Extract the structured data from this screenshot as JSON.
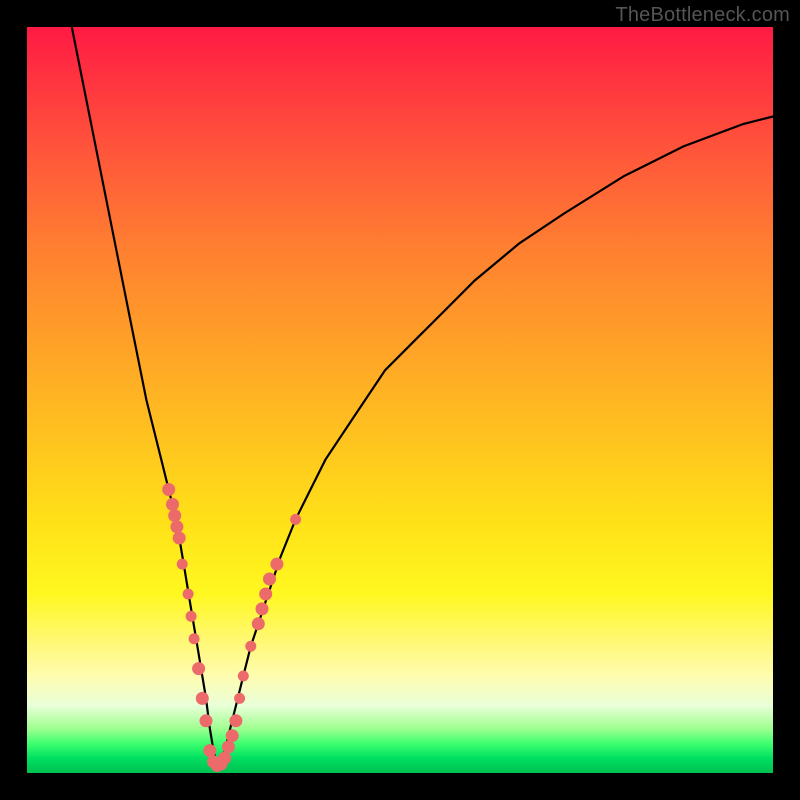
{
  "watermark": "TheBottleneck.com",
  "chart_data": {
    "type": "line",
    "title": "",
    "xlabel": "",
    "ylabel": "",
    "xlim": [
      0,
      100
    ],
    "ylim": [
      0,
      100
    ],
    "optimum_x": 25.5,
    "series": [
      {
        "name": "bottleneck-curve",
        "x": [
          6,
          8,
          10,
          12,
          14,
          16,
          18,
          19,
          20,
          21,
          22,
          23,
          24,
          24.5,
          25,
          25.5,
          26,
          26.5,
          27,
          28,
          29,
          30,
          31,
          32,
          34,
          36,
          38,
          40,
          44,
          48,
          52,
          56,
          60,
          66,
          72,
          80,
          88,
          96,
          100
        ],
        "values": [
          100,
          90,
          80,
          70,
          60,
          50,
          42,
          38,
          34,
          28,
          22,
          16,
          10,
          6,
          3,
          1,
          1.5,
          3,
          5,
          9,
          13,
          17,
          20,
          23,
          29,
          34,
          38,
          42,
          48,
          54,
          58,
          62,
          66,
          71,
          75,
          80,
          84,
          87,
          88
        ]
      }
    ],
    "markers": [
      {
        "name": "dots-left-upper",
        "x": [
          19.0,
          19.5,
          19.8,
          20.1,
          20.4
        ],
        "y": [
          38,
          36,
          34.5,
          33,
          31.5
        ],
        "r": 6
      },
      {
        "name": "dots-left-mid",
        "x": [
          20.8,
          21.6,
          22.0,
          22.4
        ],
        "y": [
          28,
          24,
          21,
          18
        ],
        "r": 5
      },
      {
        "name": "dots-left-lower",
        "x": [
          23.0,
          23.5,
          24.0
        ],
        "y": [
          14,
          10,
          7
        ],
        "r": 6
      },
      {
        "name": "dots-bottom",
        "x": [
          24.5,
          25.0,
          25.5,
          26.0,
          26.5,
          27.0,
          27.5,
          28.0
        ],
        "y": [
          3,
          1.5,
          1,
          1.2,
          2,
          3.5,
          5,
          7
        ],
        "r": 6
      },
      {
        "name": "dots-right-lower",
        "x": [
          28.5,
          29.0,
          30.0
        ],
        "y": [
          10,
          13,
          17
        ],
        "r": 5
      },
      {
        "name": "dots-right-mid",
        "x": [
          31.0,
          31.5,
          32.0,
          32.5,
          33.5
        ],
        "y": [
          20,
          22,
          24,
          26,
          28
        ],
        "r": 6
      },
      {
        "name": "dots-right-upper",
        "x": [
          36.0
        ],
        "y": [
          34
        ],
        "r": 5
      }
    ],
    "colors": {
      "curve": "#000000",
      "dot_fill": "#ec6a6a",
      "dot_stroke": "#ec6a6a"
    }
  }
}
